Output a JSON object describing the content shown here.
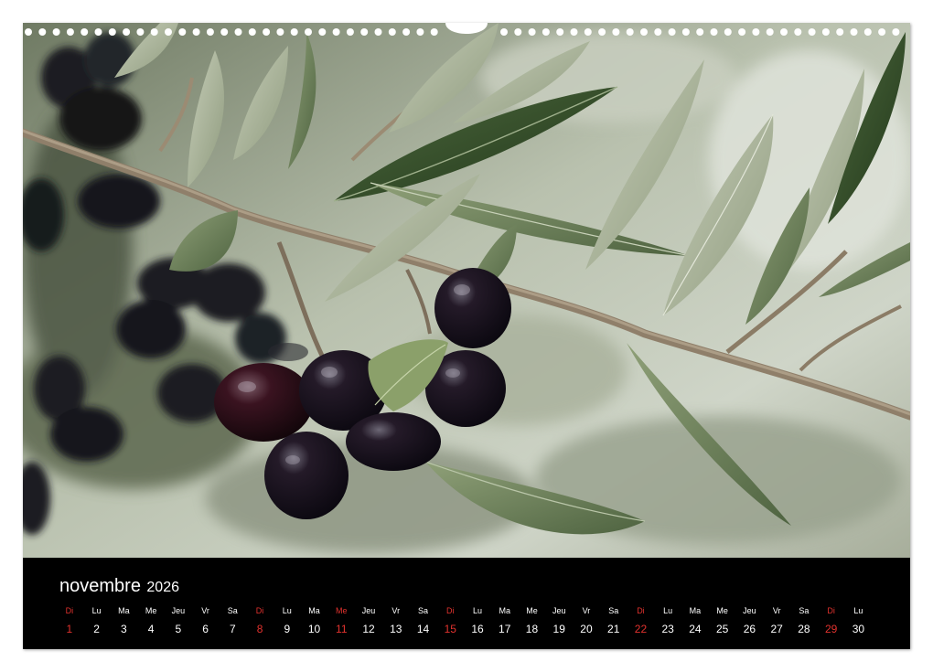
{
  "calendar": {
    "month": "novembre",
    "year": "2026",
    "days": [
      {
        "dow": "Di",
        "num": "1",
        "red": true
      },
      {
        "dow": "Lu",
        "num": "2",
        "red": false
      },
      {
        "dow": "Ma",
        "num": "3",
        "red": false
      },
      {
        "dow": "Me",
        "num": "4",
        "red": false
      },
      {
        "dow": "Jeu",
        "num": "5",
        "red": false
      },
      {
        "dow": "Vr",
        "num": "6",
        "red": false
      },
      {
        "dow": "Sa",
        "num": "7",
        "red": false
      },
      {
        "dow": "Di",
        "num": "8",
        "red": true
      },
      {
        "dow": "Lu",
        "num": "9",
        "red": false
      },
      {
        "dow": "Ma",
        "num": "10",
        "red": false
      },
      {
        "dow": "Me",
        "num": "11",
        "red": true
      },
      {
        "dow": "Jeu",
        "num": "12",
        "red": false
      },
      {
        "dow": "Vr",
        "num": "13",
        "red": false
      },
      {
        "dow": "Sa",
        "num": "14",
        "red": false
      },
      {
        "dow": "Di",
        "num": "15",
        "red": true
      },
      {
        "dow": "Lu",
        "num": "16",
        "red": false
      },
      {
        "dow": "Ma",
        "num": "17",
        "red": false
      },
      {
        "dow": "Me",
        "num": "18",
        "red": false
      },
      {
        "dow": "Jeu",
        "num": "19",
        "red": false
      },
      {
        "dow": "Vr",
        "num": "20",
        "red": false
      },
      {
        "dow": "Sa",
        "num": "21",
        "red": false
      },
      {
        "dow": "Di",
        "num": "22",
        "red": true
      },
      {
        "dow": "Lu",
        "num": "23",
        "red": false
      },
      {
        "dow": "Ma",
        "num": "24",
        "red": false
      },
      {
        "dow": "Me",
        "num": "25",
        "red": false
      },
      {
        "dow": "Jeu",
        "num": "26",
        "red": false
      },
      {
        "dow": "Vr",
        "num": "27",
        "red": false
      },
      {
        "dow": "Sa",
        "num": "28",
        "red": false
      },
      {
        "dow": "Di",
        "num": "29",
        "red": true
      },
      {
        "dow": "Lu",
        "num": "30",
        "red": false
      }
    ]
  },
  "colors": {
    "weekday_text": "#ffffff",
    "holiday_text": "#e2322e",
    "bar_background": "#000000"
  },
  "photo": {
    "subject_icon": "olive-branch-icon"
  }
}
